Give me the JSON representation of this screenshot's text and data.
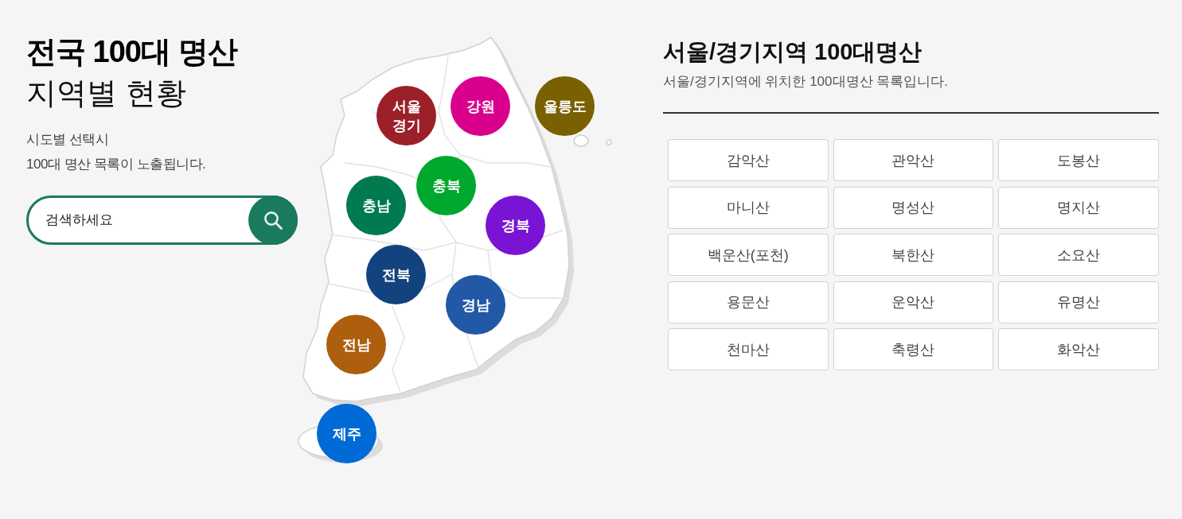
{
  "intro": {
    "title": "전국 100대 명산",
    "subtitle": "지역별 현황",
    "description": "시도별 선택시\n100대 명산 목록이 노출됩니다."
  },
  "search": {
    "placeholder": "검색하세요"
  },
  "regions": [
    {
      "label": "서울 경기",
      "color": "#9b2027"
    },
    {
      "label": "강원",
      "color": "#d9008e"
    },
    {
      "label": "울릉도",
      "color": "#7a6000"
    },
    {
      "label": "충북",
      "color": "#00a82d"
    },
    {
      "label": "충남",
      "color": "#007a4e"
    },
    {
      "label": "경북",
      "color": "#7a14d4"
    },
    {
      "label": "전북",
      "color": "#12437e"
    },
    {
      "label": "경남",
      "color": "#2259a6"
    },
    {
      "label": "전남",
      "color": "#ad5f0d"
    },
    {
      "label": "제주",
      "color": "#006bd6"
    }
  ],
  "list": {
    "title": "서울/경기지역 100대명산",
    "description": "서울/경기지역에 위치한 100대명산 목록입니다.",
    "mountains": [
      "감악산",
      "관악산",
      "도봉산",
      "마니산",
      "명성산",
      "명지산",
      "백운산(포천)",
      "북한산",
      "소요산",
      "용문산",
      "운악산",
      "유명산",
      "천마산",
      "축령산",
      "화악산"
    ]
  }
}
